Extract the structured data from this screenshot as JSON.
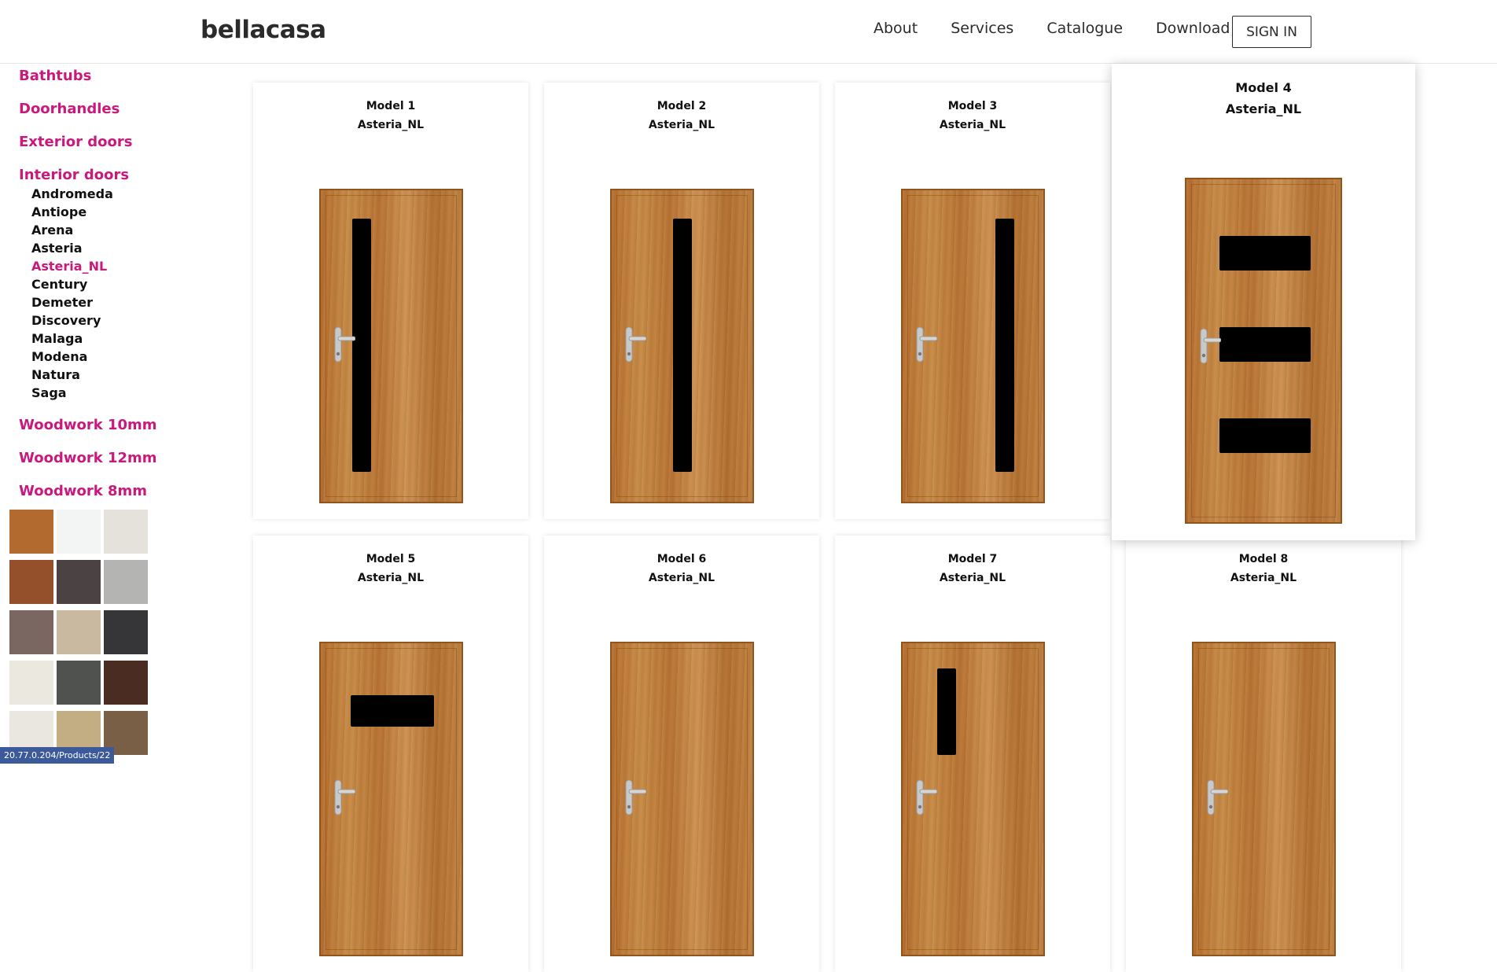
{
  "header": {
    "brand": "bellacasa",
    "nav": [
      "About",
      "Services",
      "Catalogue",
      "Download"
    ],
    "sign_in": "SIGN IN"
  },
  "sidebar": {
    "categories_top": [
      "Bathtubs",
      "Doorhandles",
      "Exterior doors",
      "Interior doors"
    ],
    "interior_doors": [
      "Andromeda",
      "Antiope",
      "Arena",
      "Asteria",
      "Asteria_NL",
      "Century",
      "Demeter",
      "Discovery",
      "Malaga",
      "Modena",
      "Natura",
      "Saga"
    ],
    "active_item": "Asteria_NL",
    "categories_bottom": [
      "Woodwork 10mm",
      "Woodwork 12mm",
      "Woodwork 8mm"
    ],
    "swatch_colors": [
      "#b36a2e",
      "#f3f4f4",
      "#e4e2da",
      "#94502a",
      "#4b4244",
      "#b4b4b2",
      "#7a6762",
      "#c9b9a1",
      "#363638",
      "#ebe8e0",
      "#4f524f",
      "#4a2c22",
      "#e9e7e0",
      "#c3ad82",
      "#7a5f47"
    ]
  },
  "products": [
    {
      "title": "Model 1",
      "series": "Asteria_NL",
      "glass": "vertical-long"
    },
    {
      "title": "Model 2",
      "series": "Asteria_NL",
      "glass": "vertical-long-center"
    },
    {
      "title": "Model 3",
      "series": "Asteria_NL",
      "glass": "vertical-long-right"
    },
    {
      "title": "Model 4",
      "series": "Asteria_NL",
      "glass": "three-horizontal"
    },
    {
      "title": "Model 5",
      "series": "Asteria_NL",
      "glass": "horizontal"
    },
    {
      "title": "Model 6",
      "series": "Asteria_NL",
      "glass": "none"
    },
    {
      "title": "Model 7",
      "series": "Asteria_NL",
      "glass": "vertical-short"
    },
    {
      "title": "Model 8",
      "series": "Asteria_NL",
      "glass": "none"
    }
  ],
  "status_url": "20.77.0.204/Products/22",
  "icons": {
    "door_handle": "door-handle-icon"
  }
}
